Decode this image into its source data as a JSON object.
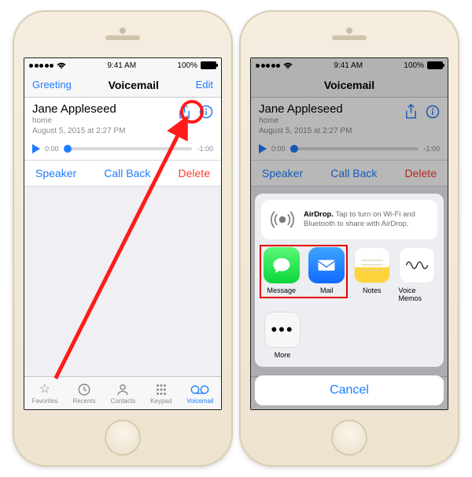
{
  "status": {
    "carrier_dots": 5,
    "time": "9:41 AM",
    "battery_pct": "100%"
  },
  "nav": {
    "left": "Greeting",
    "title": "Voicemail",
    "right": "Edit"
  },
  "voicemail": {
    "caller_name": "Jane Appleseed",
    "caller_line": "home",
    "timestamp": "August 5, 2015 at 2:27 PM",
    "elapsed": "0:00",
    "remaining": "-1:00",
    "actions": {
      "speaker": "Speaker",
      "callback": "Call Back",
      "delete": "Delete"
    }
  },
  "tabs": {
    "favorites": "Favorites",
    "recents": "Recents",
    "contacts": "Contacts",
    "keypad": "Keypad",
    "voicemail": "Voicemail"
  },
  "share": {
    "airdrop_bold": "AirDrop.",
    "airdrop_rest": " Tap to turn on Wi-Fi and Bluetooth to share with AirDrop.",
    "apps": {
      "message": "Message",
      "mail": "Mail",
      "notes": "Notes",
      "voicememos": "Voice Memos"
    },
    "more": "More",
    "cancel": "Cancel"
  }
}
